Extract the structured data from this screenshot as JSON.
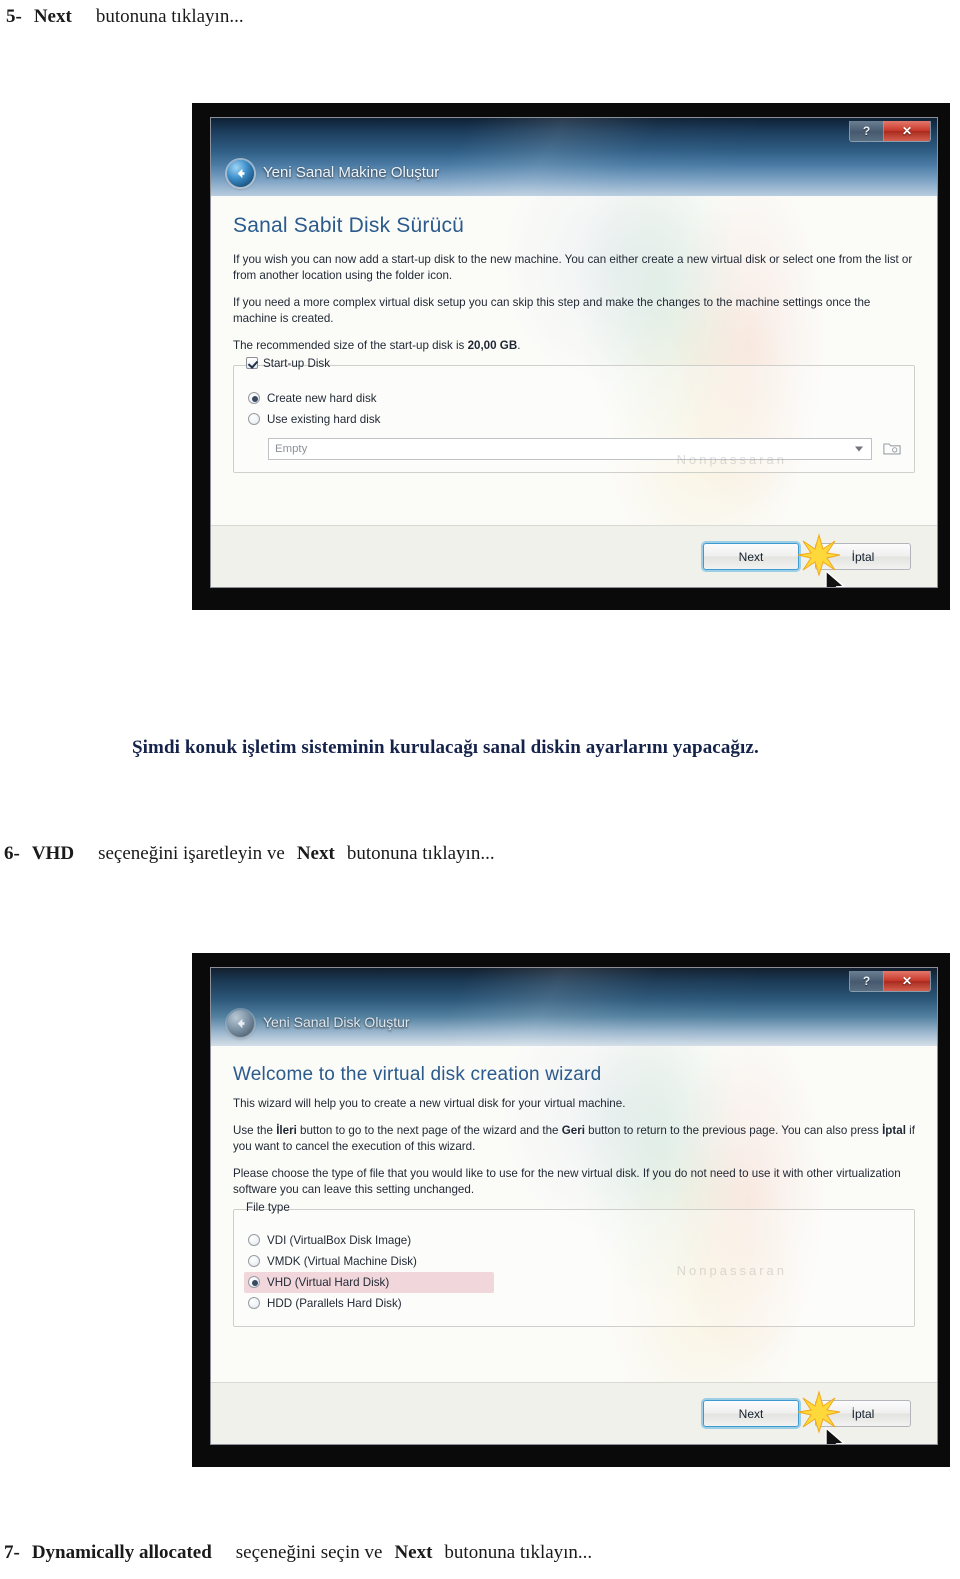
{
  "document": {
    "step5": {
      "num": "5-",
      "keyword": "Next",
      "rest": "butonuna tıklayın..."
    },
    "note": "Şimdi konuk işletim sisteminin kurulacağı sanal diskin ayarlarını yapacağız.",
    "step6": {
      "num": "6-",
      "keyword": "VHD",
      "mid": "seçeneğini işaretleyin ve",
      "keyword2": "Next",
      "rest": "butonuna tıklayın..."
    },
    "step7": {
      "num": "7-",
      "keyword": "Dynamically allocated",
      "mid": "seçeneğini seçin ve",
      "keyword2": "Next",
      "rest": "butonuna tıklayın..."
    }
  },
  "screenshot1": {
    "titlebar": {
      "title": "Yeni Sanal Makine Oluştur",
      "back_icon": "back-arrow-icon",
      "help_label": "?",
      "close_label": "✕"
    },
    "page_title": "Sanal Sabit Disk Sürücü",
    "paragraphs": [
      "If you wish you can now add a start-up disk to the new machine. You can either create a new virtual disk or select one from the list or from another location using the folder icon.",
      "If you need a more complex virtual disk setup you can skip this step and make the changes to the machine settings once the machine is created."
    ],
    "recommended_prefix": "The recommended size of the start-up disk is ",
    "recommended_size": "20,00 GB",
    "recommended_suffix": ".",
    "groupbox_legend": "Start-up Disk",
    "options": [
      {
        "label": "Create new hard disk",
        "selected": true
      },
      {
        "label": "Use existing hard disk",
        "selected": false
      }
    ],
    "combo_value": "Empty",
    "folder_icon": "folder-icon",
    "watermark": "Nonpassaran",
    "buttons": {
      "next": "Next",
      "cancel": "İptal"
    }
  },
  "screenshot2": {
    "titlebar": {
      "title": "Yeni Sanal Disk Oluştur",
      "back_icon": "back-arrow-icon",
      "help_label": "?",
      "close_label": "✕"
    },
    "page_title": "Welcome to the virtual disk creation wizard",
    "paragraphs": [
      "This wizard will help you to create a new virtual disk for your virtual machine.",
      "Please choose the type of file that you would like to use for the new virtual disk. If you do not need to use it with other virtualization software you can leave this setting unchanged."
    ],
    "nav_para": {
      "p1": "Use the ",
      "b1": "İleri",
      "p2": " button to go to the next page of the wizard and the ",
      "b2": "Geri",
      "p3": " button to return to the previous page. You can also press ",
      "b3": "İptal",
      "p4": " if you want to cancel the execution of this wizard."
    },
    "groupbox_legend": "File type",
    "file_types": [
      {
        "label": "VDI (VirtualBox Disk Image)",
        "selected": false
      },
      {
        "label": "VMDK (Virtual Machine Disk)",
        "selected": false
      },
      {
        "label": "VHD (Virtual Hard Disk)",
        "selected": true
      },
      {
        "label": "HDD (Parallels Hard Disk)",
        "selected": false
      }
    ],
    "watermark": "Nonpassaran",
    "buttons": {
      "next": "Next",
      "cancel": "İptal"
    }
  },
  "colors": {
    "accent_blue": "#2b5a8c",
    "close_red": "#c8392b",
    "highlight_pink": "#e2a4b0",
    "focus_blue": "#3d9bd1",
    "note_navy": "#15224a"
  }
}
